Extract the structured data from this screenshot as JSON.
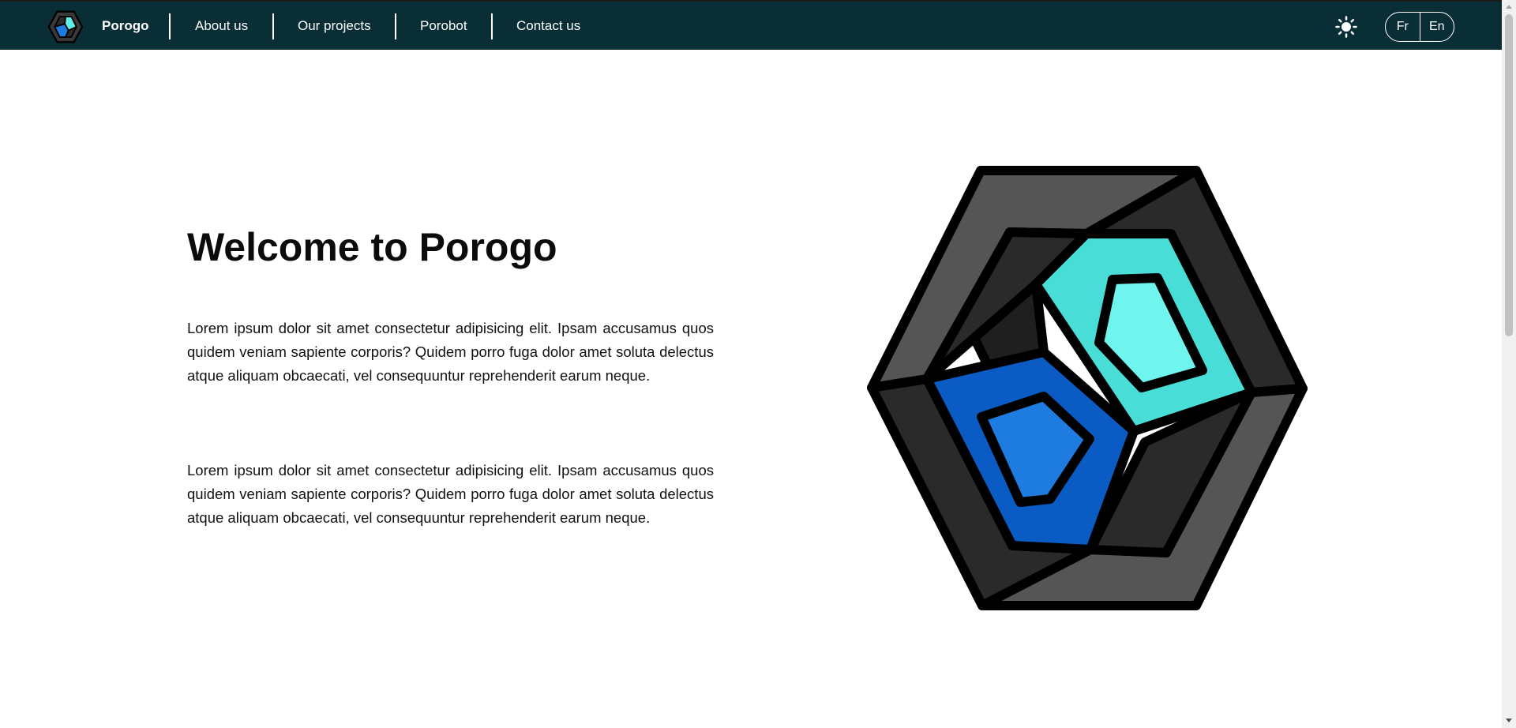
{
  "nav": {
    "brand": "Porogo",
    "links": [
      "About us",
      "Our projects",
      "Porobot",
      "Contact us"
    ],
    "theme_toggle_icon": "sun-icon",
    "languages": [
      "Fr",
      "En"
    ]
  },
  "hero": {
    "title": "Welcome to Porogo",
    "paragraphs": [
      "Lorem ipsum dolor sit amet consectetur adipisicing elit. Ipsam accusamus quos quidem veniam sapiente corporis? Quidem porro fuga dolor amet soluta delectus atque aliquam obcaecati, vel consequuntur reprehenderit earum neque.",
      "Lorem ipsum dolor sit amet consectetur adipisicing elit. Ipsam accusamus quos quidem veniam sapiente corporis? Quidem porro fuga dolor amet soluta delectus atque aliquam obcaecati, vel consequuntur reprehenderit earum neque."
    ],
    "image_icon": "porogo-hexagon-logo"
  },
  "colors": {
    "navbar": "#0a2e35",
    "hex_dark": "#2a2a2a",
    "hex_mid": "#555555",
    "gem_blue": "#1e7be0",
    "gem_blue_dark": "#0a5cc4",
    "gem_cyan": "#6ff5ee",
    "gem_cyan_dark": "#48ddd6"
  }
}
